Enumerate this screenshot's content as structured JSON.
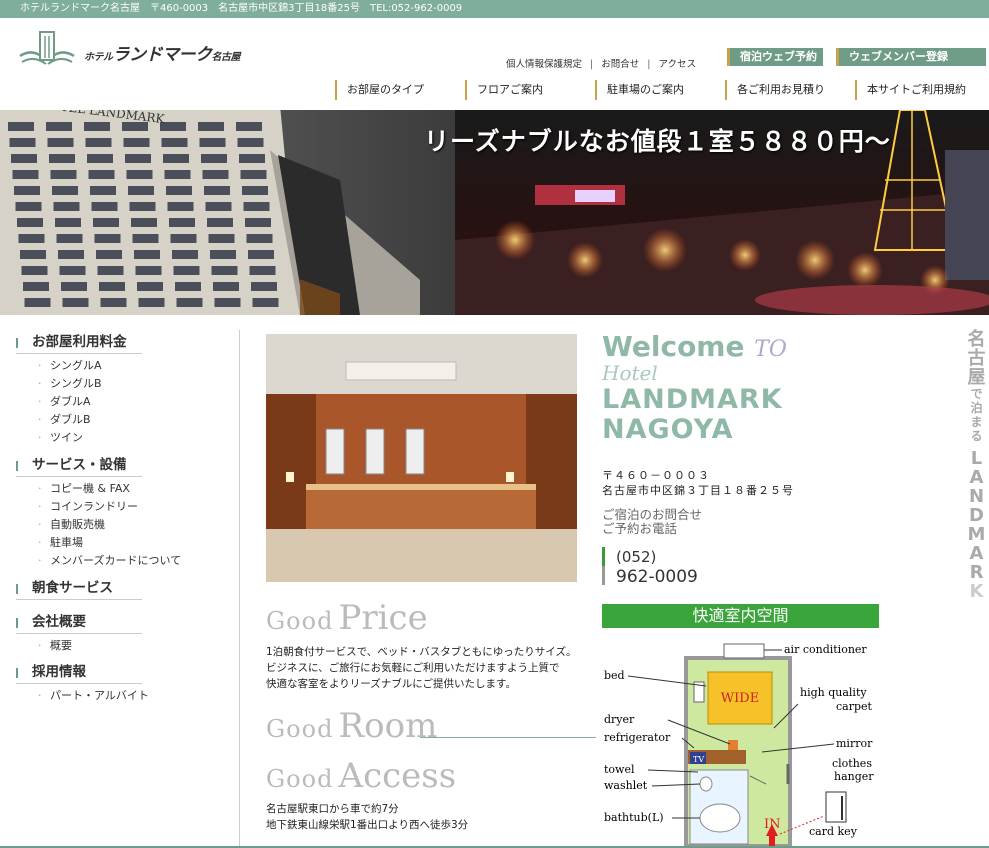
{
  "topbar": {
    "text": "ホテルランドマーク名古屋　〒460-0003　名古屋市中区錦3丁目18番25号　TEL:052-962-0009"
  },
  "header": {
    "logo_prefix": "ホテル",
    "logo_main": "ランドマーク",
    "logo_suffix": "名古屋",
    "util_links": [
      "個人情報保護規定",
      "お問合せ",
      "アクセス"
    ],
    "btn_stay": "宿泊ウェブ予約",
    "btn_member": "ウェブメンバー登録",
    "nav": [
      "お部屋のタイプ",
      "フロアご案内",
      "駐車場のご案内",
      "各ご利用お見積り",
      "本サイトご利用規約"
    ]
  },
  "hero": {
    "caption": "リーズナブルなお値段１室５８８０円～",
    "building_sign": "HOTEL LANDMARK"
  },
  "sidebar": {
    "cat_room": "お部屋利用料金",
    "room_items": [
      "シングルA",
      "シングルB",
      "ダブルA",
      "ダブルB",
      "ツイン"
    ],
    "cat_service": "サービス・設備",
    "service_items": [
      "コピー機 & FAX",
      "コインランドリー",
      "自動販売機",
      "駐車場",
      "メンバーズカードについて"
    ],
    "cat_breakfast": "朝食サービス",
    "cat_company": "会社概要",
    "company_items": [
      "概要"
    ],
    "cat_recruit": "採用情報",
    "recruit_items": [
      "パート・アルバイト"
    ]
  },
  "main": {
    "good": "Good",
    "price_word": "Price",
    "price_desc": [
      "1泊朝食付サービスで、ベッド・バスタブともにゆったりサイズ。",
      "ビジネスに、ご旅行にお気軽にご利用いただけますよう上質で",
      "快適な客室をよりリーズナブルにご提供いたします。"
    ],
    "room_word": "Room",
    "access_word": "Access",
    "access_desc": [
      "名古屋駅東口から車で約7分",
      "地下鉄東山線栄駅1番出口より西へ徒歩3分"
    ]
  },
  "welcome": {
    "welcome": "Welcome",
    "to": "TO",
    "hotel": "Hotel",
    "landmark": "LANDMARK",
    "nagoya": "NAGOYA",
    "zip": "〒４６０－０００３",
    "address": "名古屋市中区錦３丁目１８番２５号",
    "inquiry_1": "ご宿泊のお問合せ",
    "inquiry_2": "ご予約お電話",
    "tel_area": "(052)",
    "tel_num": "962-0009"
  },
  "comfort": {
    "title": "快適室内空間",
    "labels": {
      "air": "air conditioner",
      "bed": "bed",
      "wide": "WIDE",
      "carpet_1": "high quality",
      "carpet_2": "carpet",
      "dryer": "dryer",
      "fridge": "refrigerator",
      "mirror": "mirror",
      "towel": "towel",
      "washlet": "washlet",
      "hanger_1": "clothes",
      "hanger_2": "hanger",
      "bathtub": "bathtub(L)",
      "in": "IN",
      "card": "card key",
      "tv": "TV"
    }
  },
  "side_vertical": {
    "big_1": [
      "名",
      "古",
      "屋"
    ],
    "small": [
      "で",
      "泊",
      "ま",
      "る"
    ],
    "letters": [
      "L",
      "A",
      "N",
      "D",
      "M",
      "A",
      "R",
      "K"
    ]
  },
  "colors": {
    "accent": "#7fae9b",
    "gold": "#c9a24a",
    "green": "#3aa53a"
  }
}
